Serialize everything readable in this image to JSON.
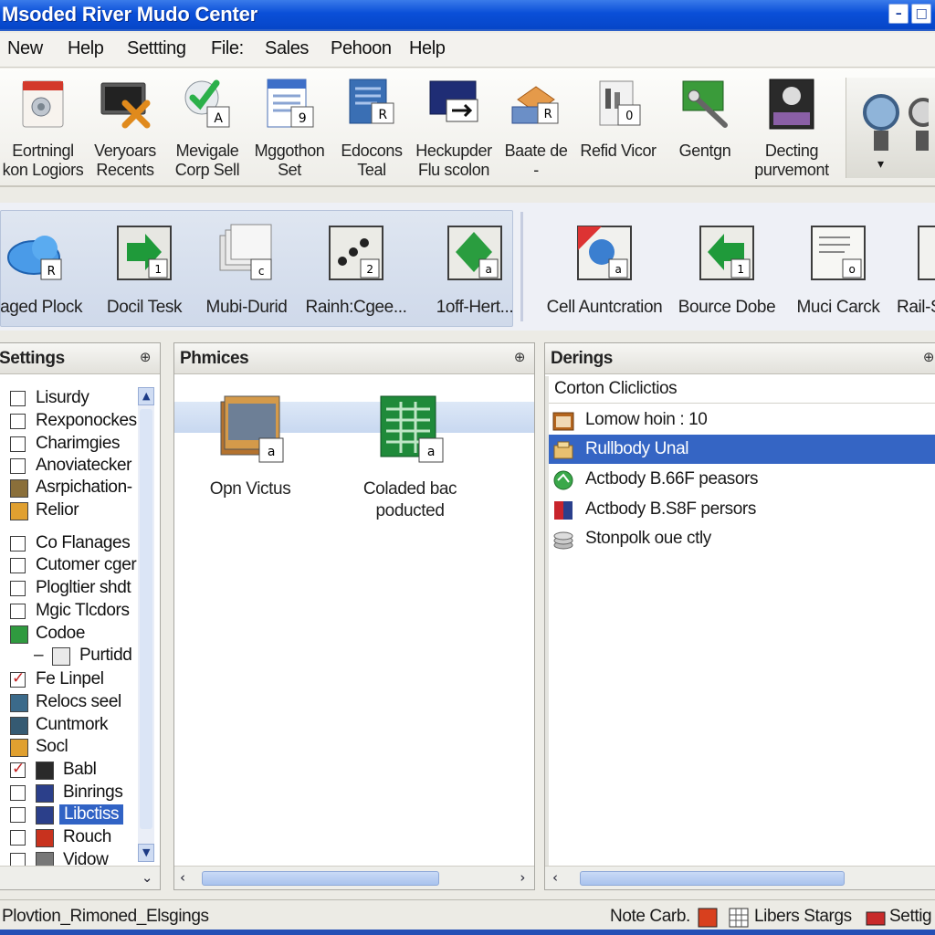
{
  "window": {
    "title": "Msoded River Mudo Center",
    "minimize_glyph": "–",
    "maximize_glyph": "□",
    "close_glyph": "×"
  },
  "menu": [
    "New",
    "Help",
    "Settting",
    "File:",
    "Sales",
    "Pehoon",
    "Help"
  ],
  "toolbar1": [
    {
      "label": "Eortningl\nkon Logiors",
      "icon": "calendar-doc-icon"
    },
    {
      "label": "Veryoars\nRecents",
      "icon": "monitor-cancel-icon"
    },
    {
      "label": "Mevigale\nCorp Sell",
      "icon": "check-doc-icon"
    },
    {
      "label": "Mggothon\nSet",
      "icon": "calendar-grid-icon"
    },
    {
      "label": "Edocons\nTeal",
      "icon": "doc-r-icon"
    },
    {
      "label": "Heckupder\nFlu scolon",
      "icon": "monitor-arrow-icon"
    },
    {
      "label": "Baate de\n-",
      "icon": "package-r-icon"
    },
    {
      "label": "Refid Vicor",
      "icon": "clipboard-icon"
    },
    {
      "label": "Gentgn",
      "icon": "screen-tool-icon"
    },
    {
      "label": "Decting\npurvemont",
      "icon": "camera-screen-icon"
    }
  ],
  "toolbar1_overflow": "▾",
  "toolbar2_left": [
    {
      "label": "Laged Plock",
      "icon": "cloud-r-icon"
    },
    {
      "label": "Docil Tesk",
      "icon": "arrow-forward-icon"
    },
    {
      "label": "Mubi-Durid",
      "icon": "stack-docs-icon"
    },
    {
      "label": "Rainh:Cgee...",
      "icon": "dots-doc-icon"
    },
    {
      "label": "1off-Hert...",
      "icon": "diamond-doc-icon"
    }
  ],
  "toolbar2_right": [
    {
      "label": "Cell Auntcration",
      "icon": "globe-doc-icon"
    },
    {
      "label": "Bource Dobe",
      "icon": "arrow-back-icon"
    },
    {
      "label": "Muci Carck",
      "icon": "list-doc-icon"
    },
    {
      "label": "Rail-S",
      "icon": "partial-doc-icon"
    }
  ],
  "settings_panel": {
    "title": "Settings",
    "items": [
      {
        "label": "Lisurdy",
        "kind": "checkbox",
        "checked": false
      },
      {
        "label": "Rexponockes",
        "kind": "checkbox",
        "checked": false
      },
      {
        "label": "Charimgies",
        "kind": "checkbox",
        "checked": false
      },
      {
        "label": "Anoviatecker",
        "kind": "checkbox",
        "checked": false
      },
      {
        "label": "Asrpichation-",
        "kind": "icon",
        "icon": "app-folder-icon"
      },
      {
        "label": "Relior",
        "kind": "icon",
        "icon": "folder-icon"
      },
      {
        "label": "Co Flanages",
        "kind": "checkbox",
        "checked": false
      },
      {
        "label": "Cutomer cger",
        "kind": "checkbox",
        "checked": false
      },
      {
        "label": "Plogltier shdt",
        "kind": "checkbox",
        "checked": false
      },
      {
        "label": "Mgic Tlcdors",
        "kind": "checkbox",
        "checked": false
      },
      {
        "label": "Codoe",
        "kind": "icon",
        "icon": "green-gear-icon"
      },
      {
        "label": "Purtidd",
        "kind": "subicon",
        "icon": "doc-icon"
      },
      {
        "label": "Fe Linpel",
        "kind": "checkbox",
        "checked": true
      },
      {
        "label": "Relocs seel",
        "kind": "icon",
        "icon": "grid-icon"
      },
      {
        "label": "Cuntmork",
        "kind": "icon",
        "icon": "table-icon"
      },
      {
        "label": "Socl",
        "kind": "icon",
        "icon": "folder-icon"
      },
      {
        "label": "Babl",
        "kind": "checkbox-icon",
        "checked": true,
        "icon": "film-icon"
      },
      {
        "label": "Binrings",
        "kind": "checkbox-icon",
        "checked": false,
        "icon": "image-icon"
      },
      {
        "label": "Libctiss",
        "kind": "checkbox-icon",
        "checked": false,
        "icon": "image-icon",
        "selected": true
      },
      {
        "label": "Rouch",
        "kind": "checkbox-icon",
        "checked": false,
        "icon": "red-box-icon"
      },
      {
        "label": "Vidow",
        "kind": "checkbox-icon",
        "checked": false,
        "icon": "pencil-icon"
      }
    ]
  },
  "phmices_panel": {
    "title": "Phmices",
    "items": [
      {
        "label": "Opn Victus",
        "icon": "photo-stack-icon"
      },
      {
        "label": "Coladed bac\npoducted",
        "icon": "spreadsheet-icon"
      }
    ]
  },
  "derings_panel": {
    "title": "Derings",
    "header": "Corton Cliclictios",
    "rows": [
      {
        "label": "Lomow hoin : 10",
        "icon": "calendar-icon",
        "selected": false
      },
      {
        "label": "Rullbody Unal",
        "icon": "package-icon",
        "selected": true
      },
      {
        "label": "Actbody B.66F peasors",
        "icon": "green-globe-icon",
        "selected": false
      },
      {
        "label": "Actbody B.S8F persors",
        "icon": "book-icon",
        "selected": false
      },
      {
        "label": "Stonpolk oue ctly",
        "icon": "stack-icon",
        "selected": false
      }
    ]
  },
  "status": {
    "left": "Plovtion_Rimoned_Elsgings",
    "note": "Note Carb.",
    "libers": "Libers Stargs",
    "setting": "Settig"
  },
  "colors": {
    "title_blue": "#0a4fd8",
    "selection_blue": "#3565c4"
  }
}
